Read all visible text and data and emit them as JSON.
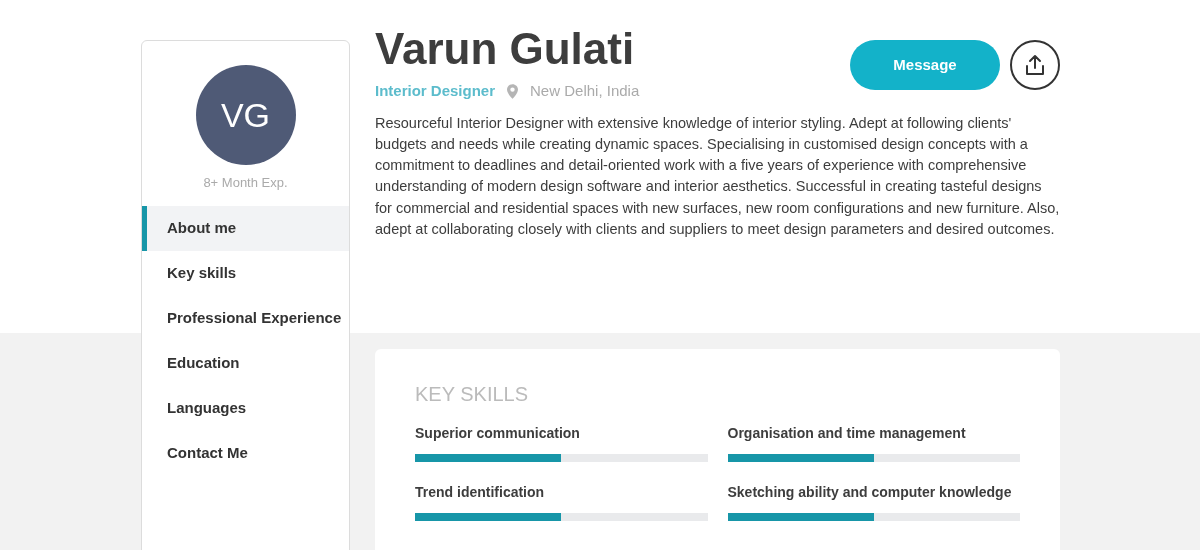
{
  "profile": {
    "initials": "VG",
    "experience": "8+ Month Exp.",
    "name": "Varun Gulati",
    "role": "Interior Designer",
    "location": "New Delhi, India",
    "about": "Resourceful Interior Designer with extensive knowledge of interior styling. Adept at following clients' budgets and needs while creating dynamic spaces. Specialising in customised design concepts with a commitment to deadlines and detail-oriented work with a five years of experience with comprehensive understanding of modern design software and interior aesthetics. Successful in creating tasteful designs for commercial and residential spaces with new surfaces, new room configurations and new furniture. Also, adept at collaborating closely with clients and suppliers to meet design parameters and desired outcomes.",
    "message_button": "Message"
  },
  "sidebar": {
    "items": [
      {
        "label": "About me",
        "selected": true
      },
      {
        "label": "Key skills",
        "selected": false
      },
      {
        "label": "Professional Experience",
        "selected": false
      },
      {
        "label": "Education",
        "selected": false
      },
      {
        "label": "Languages",
        "selected": false
      },
      {
        "label": "Contact Me",
        "selected": false
      }
    ]
  },
  "key_skills": {
    "title": "KEY SKILLS",
    "skills": [
      {
        "name": "Superior communication",
        "level": 0.5
      },
      {
        "name": "Organisation and time management",
        "level": 0.5
      },
      {
        "name": "Trend identification",
        "level": 0.5
      },
      {
        "name": "Sketching ability and computer knowledge",
        "level": 0.5
      }
    ]
  }
}
